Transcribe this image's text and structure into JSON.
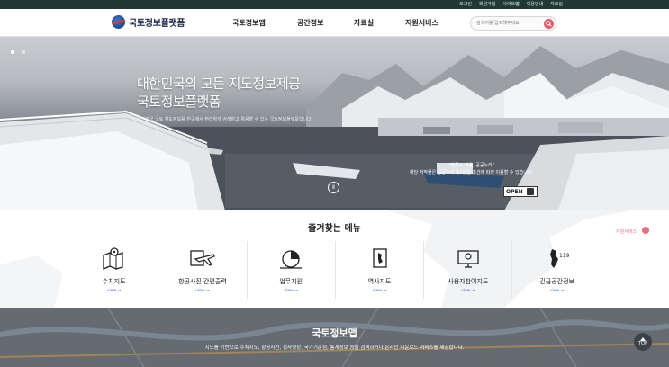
{
  "topbar": {
    "links": [
      "로그인",
      "회원가입",
      "사이트맵",
      "이용안내",
      "자료실"
    ]
  },
  "header": {
    "logo_text": "국토정보플랫폼",
    "nav": [
      "국토정보맵",
      "공간정보",
      "자료실",
      "지원서비스"
    ],
    "search_placeholder": "검색어를 입력해주세요."
  },
  "hero": {
    "title_line1": "대한민국의 모든 지도정보제공",
    "title_line2": "국토정보플랫폼",
    "subtitle": "대한민국 국토 지도정보를 한곳에서 편리하게 검색하고 활용할 수 있는 국토정보플랫폼입니다.",
    "caption_title": "\"울릉도 겨울, 공공누리\"",
    "caption_text": "해당 저작물은 공공누리 제1유형 조건에 따라 이용할 수 있습니다.",
    "open_label": "OPEN",
    "pause_label": "Ⅱ"
  },
  "favorites": {
    "title": "즐겨찾는 메뉴",
    "support_label": "지원서비스",
    "items": [
      {
        "label": "수치지도",
        "view": "view →"
      },
      {
        "label": "항공사진 간편출력",
        "view": "view →"
      },
      {
        "label": "업무지원",
        "view": "view →"
      },
      {
        "label": "역사지도",
        "view": "view →"
      },
      {
        "label": "사용자참여지도",
        "view": "view →"
      },
      {
        "label": "긴급공간정보",
        "view": "view →"
      }
    ]
  },
  "mapband": {
    "title": "국토정보맵",
    "desc": "지도를 기반으로 수치지도, 항공사진, 정사영상, 국가기준점, 통계정보 등을 검색하거나 온라인 다운로드 서비스를 제공합니다."
  },
  "top_button": "TOP",
  "colors": {
    "topbar": "#1f3a34",
    "accent": "#e85a6b",
    "link": "#2f6fd1"
  }
}
